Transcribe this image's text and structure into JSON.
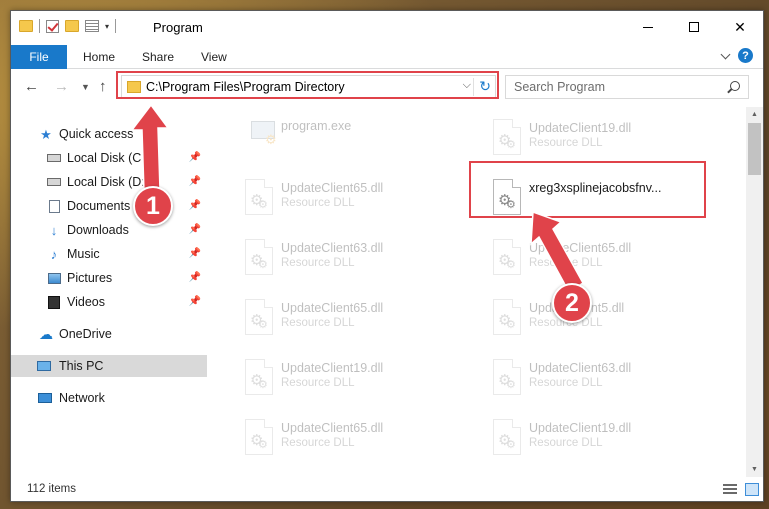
{
  "window": {
    "title": "Program"
  },
  "ribbon": {
    "tabs": [
      "File",
      "Home",
      "Share",
      "View"
    ]
  },
  "navigation": {
    "address_path": "C:\\Program Files\\Program Directory",
    "search_placeholder": "Search Program"
  },
  "sidebar": {
    "items": [
      {
        "label": "Quick access",
        "icon": "star-icon",
        "pinned": false
      },
      {
        "label": "Local Disk (C:)",
        "icon": "drive-icon",
        "pinned": true
      },
      {
        "label": "Local Disk (D:)",
        "icon": "drive-icon",
        "pinned": true
      },
      {
        "label": "Documents",
        "icon": "documents-icon",
        "pinned": true
      },
      {
        "label": "Downloads",
        "icon": "download-icon",
        "pinned": true
      },
      {
        "label": "Music",
        "icon": "music-icon",
        "pinned": true
      },
      {
        "label": "Pictures",
        "icon": "pictures-icon",
        "pinned": true
      },
      {
        "label": "Videos",
        "icon": "videos-icon",
        "pinned": true
      },
      {
        "label": "OneDrive",
        "icon": "cloud-icon",
        "pinned": false
      },
      {
        "label": "This PC",
        "icon": "computer-icon",
        "pinned": false,
        "selected": true
      },
      {
        "label": "Network",
        "icon": "network-icon",
        "pinned": false
      }
    ]
  },
  "files": {
    "left": [
      {
        "name": "program.exe",
        "type": ""
      },
      {
        "name": "UpdateClient65.dll",
        "type": "Resource DLL"
      },
      {
        "name": "UpdateClient63.dll",
        "type": "Resource DLL"
      },
      {
        "name": "UpdateClient65.dll",
        "type": "Resource DLL"
      },
      {
        "name": "UpdateClient19.dll",
        "type": "Resource DLL"
      },
      {
        "name": "UpdateClient65.dll",
        "type": "Resource DLL"
      }
    ],
    "right": [
      {
        "name": "UpdateClient19.dll",
        "type": "Resource DLL"
      },
      {
        "name": "xreg3xsplinejacobsfnv...",
        "type": ""
      },
      {
        "name": "UpdateClient65.dll",
        "type": "Resource DLL"
      },
      {
        "name": "UpdateClient5.dll",
        "type": "Resource DLL"
      },
      {
        "name": "UpdateClient63.dll",
        "type": "Resource DLL"
      },
      {
        "name": "UpdateClient19.dll",
        "type": "Resource DLL"
      }
    ]
  },
  "status": {
    "item_count": "112 items"
  },
  "annotations": {
    "callout_1": "1",
    "callout_2": "2",
    "accent_color": "#e0434a"
  }
}
